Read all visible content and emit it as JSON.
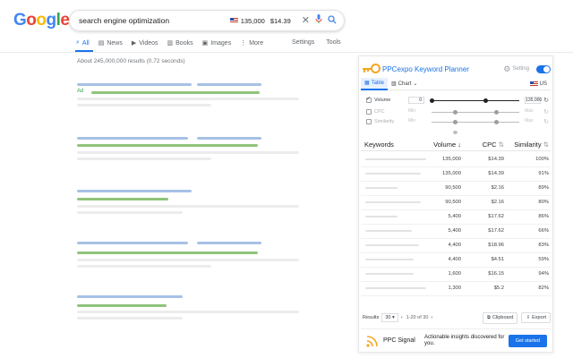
{
  "logo": [
    "G",
    "o",
    "o",
    "g",
    "l",
    "e"
  ],
  "search": {
    "query": "search engine optimization",
    "volume": "135,000",
    "cpc": "$14.39"
  },
  "tabs": {
    "items": [
      {
        "label": "All",
        "icon": "search-icon"
      },
      {
        "label": "News",
        "icon": "news-icon"
      },
      {
        "label": "Videos",
        "icon": "video-icon"
      },
      {
        "label": "Books",
        "icon": "book-icon"
      },
      {
        "label": "Images",
        "icon": "image-icon"
      },
      {
        "label": "More",
        "icon": "more-icon"
      }
    ],
    "settings": "Settings",
    "tools": "Tools"
  },
  "results_count": "About 245,000,000 results (0.72 seconds)",
  "ad_label": "Ad",
  "panel": {
    "title": "PPCexpo Keyword Planner",
    "setting_label": "Setting",
    "tab_table": "Table",
    "tab_chart": "Chart",
    "country": "US",
    "filters": [
      {
        "label": "Volume",
        "min": "0",
        "max": "135,000",
        "enabled": true
      },
      {
        "label": "CPC",
        "min": "Min",
        "max": "Max",
        "enabled": false
      },
      {
        "label": "Similarity",
        "min": "Min",
        "max": "Max",
        "enabled": false
      }
    ],
    "columns": {
      "keywords": "Keywords",
      "volume": "Volume",
      "cpc": "CPC",
      "similarity": "Similarity"
    },
    "rows": [
      {
        "volume": "135,000",
        "cpc": "$14.39",
        "similarity": "100%"
      },
      {
        "volume": "135,000",
        "cpc": "$14.39",
        "similarity": "91%"
      },
      {
        "volume": "90,500",
        "cpc": "$2.16",
        "similarity": "89%"
      },
      {
        "volume": "90,500",
        "cpc": "$2.16",
        "similarity": "80%"
      },
      {
        "volume": "5,400",
        "cpc": "$17.62",
        "similarity": "86%"
      },
      {
        "volume": "5,400",
        "cpc": "$17.62",
        "similarity": "66%"
      },
      {
        "volume": "4,400",
        "cpc": "$18.96",
        "similarity": "83%"
      },
      {
        "volume": "4,400",
        "cpc": "$4.51",
        "similarity": "59%"
      },
      {
        "volume": "1,600",
        "cpc": "$16.15",
        "similarity": "94%"
      },
      {
        "volume": "1,300",
        "cpc": "$5.2",
        "similarity": "82%"
      }
    ],
    "footer": {
      "results_label": "Results",
      "page_size": "30",
      "pager": "1-20 of 30",
      "clipboard": "Clipboard",
      "export": "Export"
    },
    "banner": {
      "name": "PPC Signal",
      "text": "Actionable insights discovered for you.",
      "button": "Get started"
    }
  },
  "colors": {
    "accent": "#1a73e8",
    "brand_orange": "#f5a623"
  }
}
